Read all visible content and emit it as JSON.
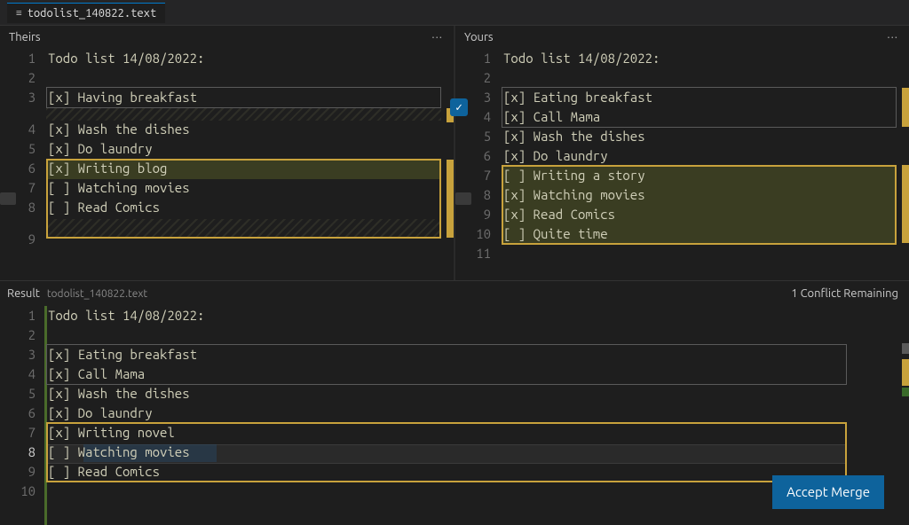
{
  "tab": {
    "icon": "≡",
    "filename": "todolist_140822.text"
  },
  "theirs": {
    "title": "Theirs",
    "ellips": "···",
    "lines": {
      "1": "Todo list 14/08/2022:",
      "2": "",
      "3": "[x] Having breakfast",
      "4": "[x] Wash the dishes",
      "5": "[x] Do laundry",
      "6": "[x] Writing blog",
      "7": "[ ] Watching movies",
      "8": "[ ] Read Comics",
      "9": ""
    }
  },
  "yours": {
    "title": "Yours",
    "ellips": "···",
    "lines": {
      "1": "Todo list 14/08/2022:",
      "2": "",
      "3": "[x] Eating breakfast",
      "4": "[x] Call Mama",
      "5": "[x] Wash the dishes",
      "6": "[x] Do laundry",
      "7": "[ ] Writing a story",
      "8": "[x] Watching movies",
      "9": "[x] Read Comics",
      "10": "[ ] Quite time",
      "11": ""
    }
  },
  "result": {
    "label": "Result",
    "filename": "todolist_140822.text",
    "status": "1 Conflict Remaining",
    "lines": {
      "1": "Todo list 14/08/2022:",
      "2": "",
      "3": "[x] Eating breakfast",
      "4": "[x] Call Mama",
      "5": "[x] Wash the dishes",
      "6": "[x] Do laundry",
      "7": "[x] Writing novel",
      "8": "[ ] Watching movies",
      "9": "[ ] Read Comics",
      "10": ""
    }
  },
  "buttons": {
    "accept_merge": "Accept Merge"
  },
  "glyphs": {
    "check": "✓"
  }
}
